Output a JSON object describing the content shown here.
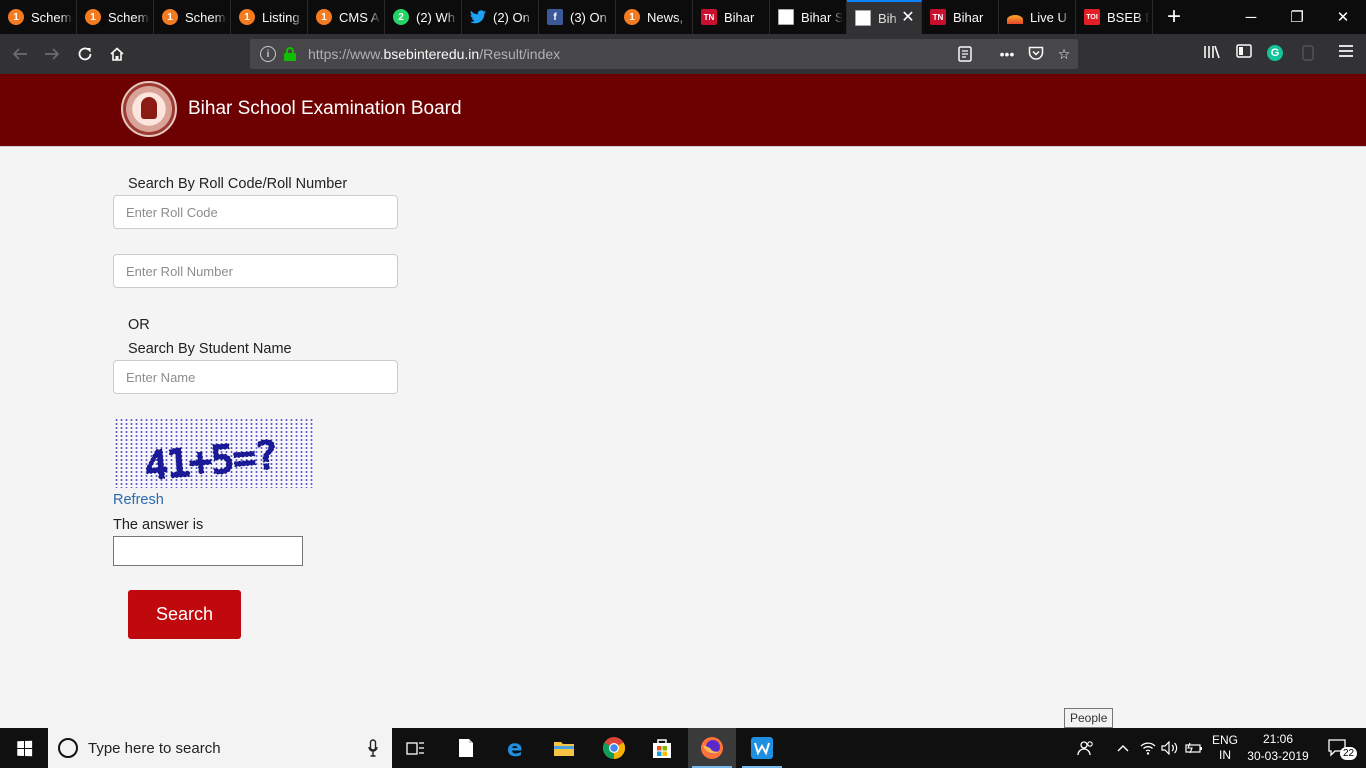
{
  "browser": {
    "tabs": [
      {
        "title": "Scheme",
        "icon": "orange-1-icon"
      },
      {
        "title": "Scheme",
        "icon": "orange-1-icon"
      },
      {
        "title": "Scheme",
        "icon": "orange-1-icon"
      },
      {
        "title": "Listing",
        "icon": "orange-1-icon"
      },
      {
        "title": "CMS A",
        "icon": "orange-1-icon"
      },
      {
        "title": "(2) Wh",
        "icon": "whatsapp-icon"
      },
      {
        "title": "(2) On",
        "icon": "twitter-icon"
      },
      {
        "title": "(3) On",
        "icon": "facebook-icon"
      },
      {
        "title": "News,",
        "icon": "orange-1-icon"
      },
      {
        "title": "Bihar",
        "icon": "tn-icon"
      },
      {
        "title": "Bihar S",
        "icon": "document-icon"
      },
      {
        "title": "Bih",
        "icon": "document-icon",
        "active": true
      },
      {
        "title": "Bihar",
        "icon": "tn-icon"
      },
      {
        "title": "Live U",
        "icon": "sunrise-icon"
      },
      {
        "title": "BSEB E",
        "icon": "toi-icon"
      }
    ],
    "favicon_text": {
      "one": "1",
      "two": "2",
      "f": "f",
      "tn": "TN",
      "toi": "TOI"
    },
    "url": {
      "scheme": "https://www.",
      "domain": "bsebinteredu.in",
      "path": "/Result/index"
    }
  },
  "site": {
    "title": "Bihar School Examination Board",
    "colors": {
      "header": "#6d0000",
      "button": "#c0090c",
      "link": "#2a6ab0"
    }
  },
  "form": {
    "roll_heading": "Search By Roll Code/Roll Number",
    "roll_code_placeholder": "Enter Roll Code",
    "roll_number_placeholder": "Enter Roll Number",
    "or_label": "OR",
    "name_heading": "Search By Student Name",
    "name_placeholder": "Enter Name",
    "captcha_text": "41+5=?",
    "refresh_label": "Refresh",
    "answer_label": "The answer is",
    "answer_value": "",
    "search_label": "Search"
  },
  "tooltip": "People",
  "taskbar": {
    "search_placeholder": "Type here to search",
    "language_top": "ENG",
    "language_bottom": "IN",
    "time": "21:06",
    "date": "30-03-2019",
    "notifications": "22"
  }
}
